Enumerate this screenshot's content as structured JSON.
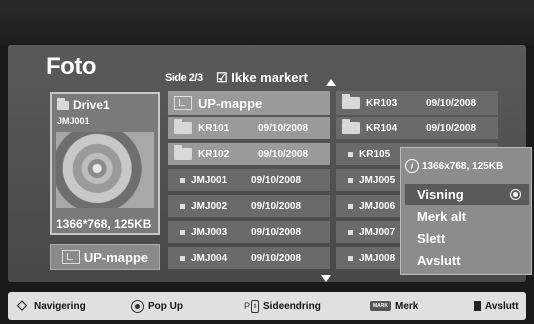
{
  "title": "Foto",
  "page_info": "Side 2/3",
  "mark_status": "☑ Ikke markert",
  "drive": {
    "name": "Drive1",
    "subtitle": "JMJ001",
    "resolution": "1366*768, 125KB"
  },
  "up_button": "UP-mappe",
  "grid": {
    "up_folder": "UP-mappe",
    "left": [
      {
        "name": "KR101",
        "date": "09/10/2008",
        "type": "folder"
      },
      {
        "name": "KR102",
        "date": "09/10/2008",
        "type": "folder"
      },
      {
        "name": "JMJ001",
        "date": "09/10/2008",
        "type": "file"
      },
      {
        "name": "JMJ002",
        "date": "09/10/2008",
        "type": "file"
      },
      {
        "name": "JMJ003",
        "date": "09/10/2008",
        "type": "file"
      },
      {
        "name": "JMJ004",
        "date": "09/10/2008",
        "type": "file"
      }
    ],
    "right": [
      {
        "name": "KR103",
        "date": "09/10/2008",
        "type": "folder"
      },
      {
        "name": "KR104",
        "date": "09/10/2008",
        "type": "folder"
      },
      {
        "name": "KR105",
        "date": "",
        "type": "file"
      },
      {
        "name": "JMJ005",
        "date": "",
        "type": "file"
      },
      {
        "name": "JMJ006",
        "date": "",
        "type": "file"
      },
      {
        "name": "JMJ007",
        "date": "",
        "type": "file"
      },
      {
        "name": "JMJ008",
        "date": "",
        "type": "file"
      }
    ]
  },
  "popup": {
    "info": "1366x768, 125KB",
    "items": [
      "Visning",
      "Merk alt",
      "Slett",
      "Avslutt"
    ]
  },
  "footer": {
    "navigate": "Navigering",
    "popup": "Pop Up",
    "page_prefix": "P",
    "page_change": "Sideendring",
    "mark_key": "MARK",
    "mark": "Merk",
    "exit": "Avslutt"
  }
}
